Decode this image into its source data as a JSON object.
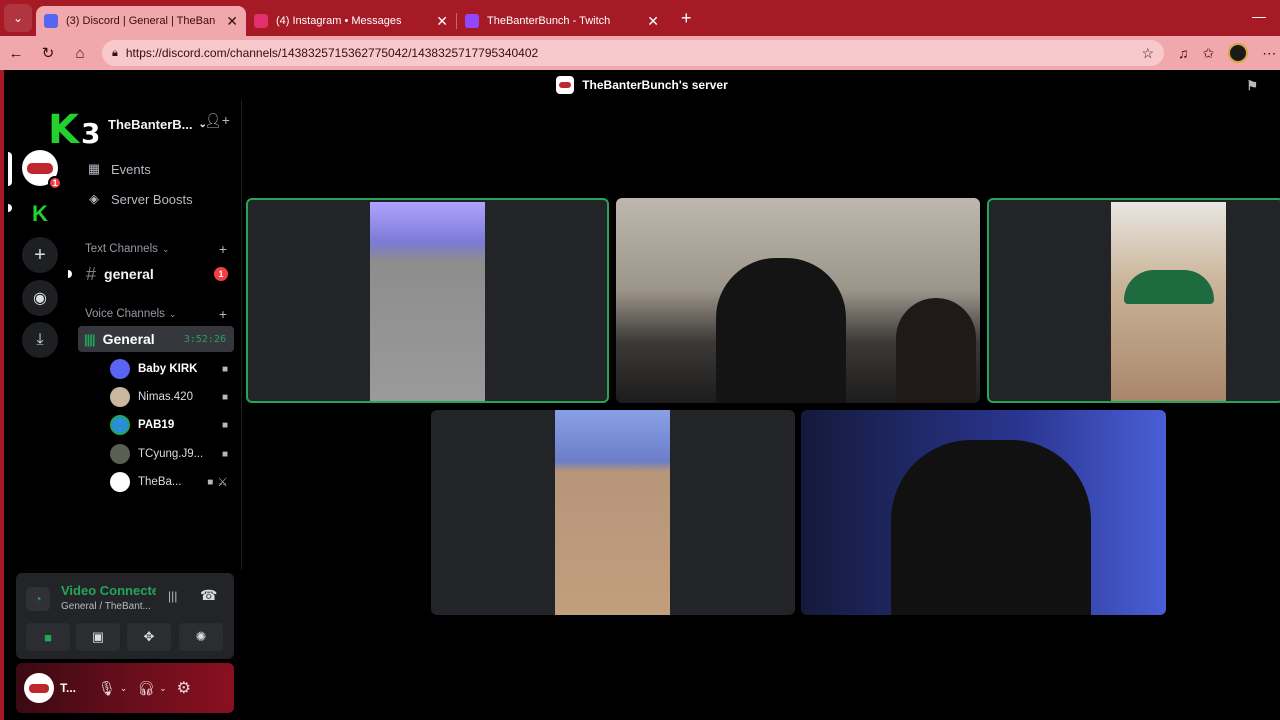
{
  "browser": {
    "tabs": [
      {
        "title": "(3) Discord | General | TheBan",
        "active": true,
        "color": "#5865f2"
      },
      {
        "title": "(4) Instagram • Messages",
        "active": false,
        "color": "#e1306c"
      },
      {
        "title": "TheBanterBunch - Twitch",
        "active": false,
        "color": "#9146ff"
      }
    ],
    "url": "https://discord.com/channels/1438325715362775042/1438325717795340402"
  },
  "topbar": {
    "server_title": "TheBanterBunch's server"
  },
  "server": {
    "name": "TheBanterB...",
    "overlay_k": "K",
    "overlay_num": "3",
    "events_label": "Events",
    "boosts_label": "Server Boosts",
    "text_category": "Text Channels",
    "text_channel": "general",
    "text_unread": "1",
    "voice_category": "Voice Channels",
    "voice_channel": "General",
    "voice_timer": "3:52:26",
    "guild_badge": "1"
  },
  "members": [
    {
      "name": "Baby KIRK",
      "color": "#5865f2"
    },
    {
      "name": "Nimas.420",
      "color": "#c9b7a0"
    },
    {
      "name": "PAB19",
      "color": "#2a8fd6"
    },
    {
      "name": "TCyung.J9...",
      "color": "#5a5f54"
    },
    {
      "name": "TheBa...",
      "color": "#ffffff"
    }
  ],
  "voice_panel": {
    "status": "Video Connected",
    "location": "General / TheBant..."
  },
  "user": {
    "name": "T..."
  }
}
